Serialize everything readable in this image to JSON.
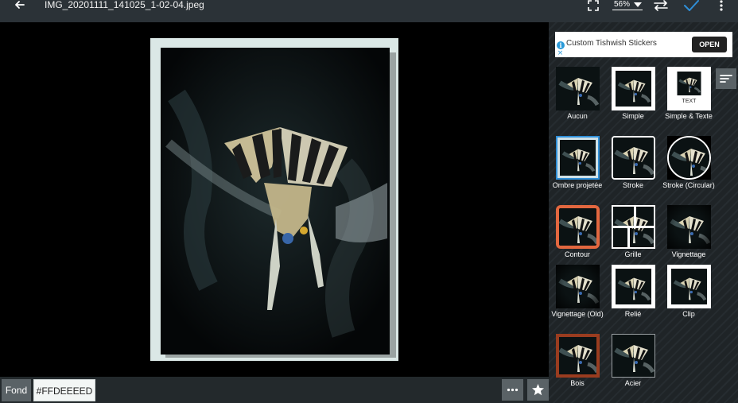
{
  "header": {
    "title": "IMG_20201111_141025_1-02-04.jpeg",
    "zoom": "56%"
  },
  "ad": {
    "text": "Custom Tishwish Stickers",
    "button": "OPEN",
    "info_symbol": "i",
    "close_symbol": "×"
  },
  "bottom": {
    "fond_label": "Fond",
    "color_value": "#FFDEEEED"
  },
  "frames": [
    {
      "label": "Aucun",
      "style": "none"
    },
    {
      "label": "Simple",
      "style": "simple"
    },
    {
      "label": "Simple & Texte",
      "style": "simple-text",
      "thumb_text": "TEXT"
    },
    {
      "label": "Ombre projetée",
      "style": "shadow",
      "selected": true
    },
    {
      "label": "Stroke",
      "style": "stroke"
    },
    {
      "label": "Stroke (Circular)",
      "style": "circle"
    },
    {
      "label": "Contour",
      "style": "contour"
    },
    {
      "label": "Grille",
      "style": "grid"
    },
    {
      "label": "Vignettage",
      "style": "vignette"
    },
    {
      "label": "Vignettage (Old)",
      "style": "vignette-old"
    },
    {
      "label": "Relié",
      "style": "bound"
    },
    {
      "label": "Clip",
      "style": "clip"
    },
    {
      "label": "Bois",
      "style": "wood"
    },
    {
      "label": "Acier",
      "style": "steel"
    }
  ],
  "colors": {
    "accent": "#2f8fd8",
    "contour": "#e2673f",
    "wood": "#9a3c1f",
    "steel": "#9aa0a3",
    "background_frame": "#dbe8e6"
  }
}
